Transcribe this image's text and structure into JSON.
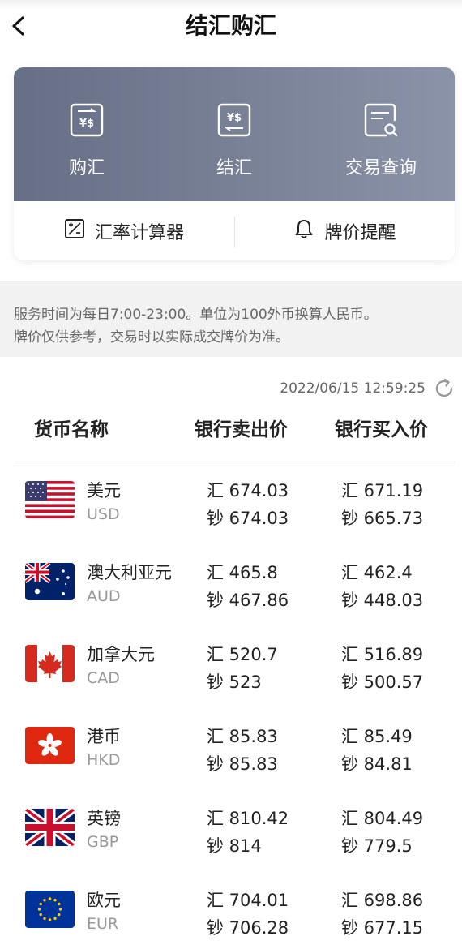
{
  "header": {
    "title": "结汇购汇"
  },
  "actions": [
    {
      "label": "购汇",
      "icon": "exchange-buy-icon"
    },
    {
      "label": "结汇",
      "icon": "exchange-settle-icon"
    },
    {
      "label": "交易查询",
      "icon": "transaction-search-icon"
    }
  ],
  "tools": [
    {
      "label": "汇率计算器",
      "icon": "calculator-icon"
    },
    {
      "label": "牌价提醒",
      "icon": "bell-icon"
    }
  ],
  "notice": {
    "line1": "服务时间为每日7:00-23:00。单位为100外币换算人民币。",
    "line2": "牌价仅供参考，交易时以实际成交牌价为准。"
  },
  "timestamp": "2022/06/15 12:59:25",
  "table": {
    "headers": [
      "货币名称",
      "银行卖出价",
      "银行买入价"
    ],
    "rows": [
      {
        "name": "美元",
        "code": "USD",
        "flag": "us-flag-icon",
        "sell_hui": "汇 674.03",
        "sell_chao": "钞 674.03",
        "buy_hui": "汇 671.19",
        "buy_chao": "钞 665.73"
      },
      {
        "name": "澳大利亚元",
        "code": "AUD",
        "flag": "au-flag-icon",
        "sell_hui": "汇 465.8",
        "sell_chao": "钞 467.86",
        "buy_hui": "汇 462.4",
        "buy_chao": "钞 448.03"
      },
      {
        "name": "加拿大元",
        "code": "CAD",
        "flag": "ca-flag-icon",
        "sell_hui": "汇 520.7",
        "sell_chao": "钞 523",
        "buy_hui": "汇 516.89",
        "buy_chao": "钞 500.57"
      },
      {
        "name": "港币",
        "code": "HKD",
        "flag": "hk-flag-icon",
        "sell_hui": "汇 85.83",
        "sell_chao": "钞 85.83",
        "buy_hui": "汇 85.49",
        "buy_chao": "钞 84.81"
      },
      {
        "name": "英镑",
        "code": "GBP",
        "flag": "gb-flag-icon",
        "sell_hui": "汇 810.42",
        "sell_chao": "钞 814",
        "buy_hui": "汇 804.49",
        "buy_chao": "钞 779.5"
      },
      {
        "name": "欧元",
        "code": "EUR",
        "flag": "eu-flag-icon",
        "sell_hui": "汇 704.01",
        "sell_chao": "钞 706.28",
        "buy_hui": "汇 698.86",
        "buy_chao": "钞 677.15"
      }
    ]
  },
  "colors": {
    "card_gradient_start": "#666f86",
    "card_gradient_end": "#8b93a8",
    "notice_bg": "#f2f2f2"
  }
}
